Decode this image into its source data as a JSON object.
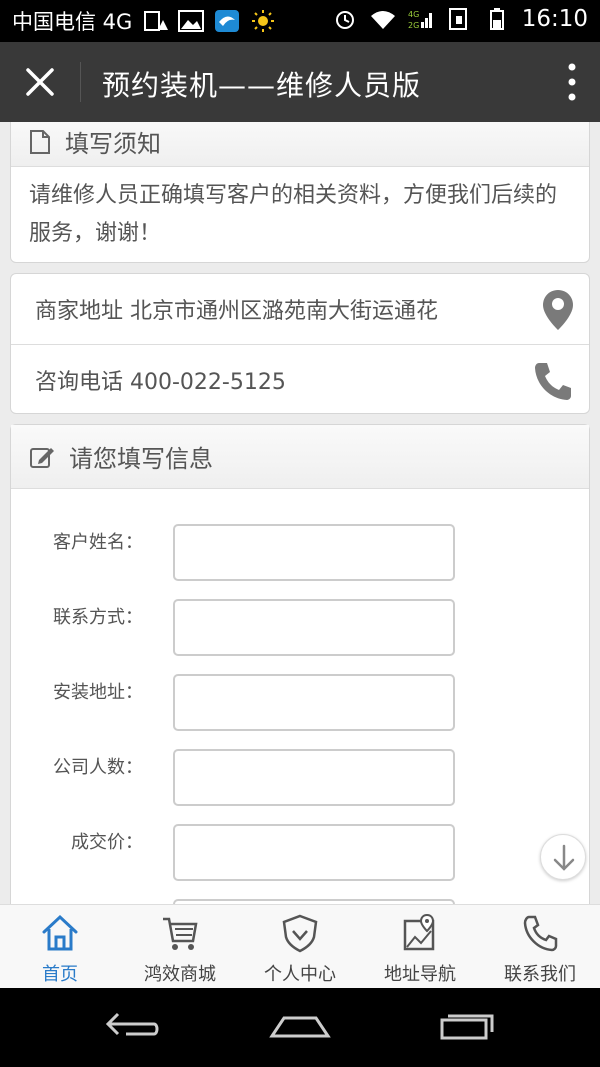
{
  "status_bar": {
    "carrier": "中国电信 4G",
    "time": "16:10",
    "network_badge": "4G 2G"
  },
  "header": {
    "title": "预约装机——维修人员版"
  },
  "notice": {
    "title": "填写须知",
    "body": "请维修人员正确填写客户的相关资料，方便我们后续的服务，谢谢！"
  },
  "contact": {
    "address": "商家地址 北京市通州区潞苑南大街运通花",
    "phone": "咨询电话 400-022-5125"
  },
  "form": {
    "title": "请您填写信息",
    "fields": [
      {
        "label": "客户姓名：",
        "value": ""
      },
      {
        "label": "联系方式：",
        "value": ""
      },
      {
        "label": "安装地址：",
        "value": ""
      },
      {
        "label": "公司人数：",
        "value": ""
      },
      {
        "label": "成交价：",
        "value": ""
      }
    ]
  },
  "bottom_nav": {
    "items": [
      {
        "label": "首页",
        "icon": "home-icon",
        "active": true
      },
      {
        "label": "鸿效商城",
        "icon": "cart-icon"
      },
      {
        "label": "个人中心",
        "icon": "shield-icon"
      },
      {
        "label": "地址导航",
        "icon": "map-icon"
      },
      {
        "label": "联系我们",
        "icon": "phone-icon"
      }
    ]
  },
  "colors": {
    "accent": "#2a7bc9",
    "title_bar": "#393939",
    "background": "#ececec"
  }
}
